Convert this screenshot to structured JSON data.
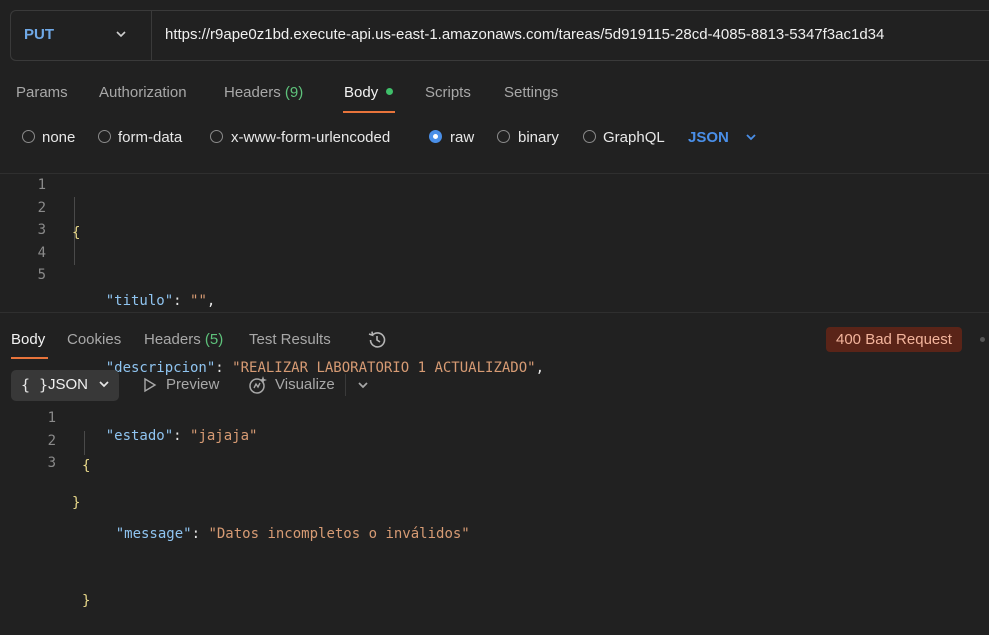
{
  "request": {
    "method": "PUT",
    "url": "https://r9ape0z1bd.execute-api.us-east-1.amazonaws.com/tareas/5d919115-28cd-4085-8813-5347f3ac1d34"
  },
  "request_tabs": {
    "params": "Params",
    "authorization": "Authorization",
    "headers": "Headers",
    "headers_count": "(9)",
    "body": "Body",
    "scripts": "Scripts",
    "settings": "Settings"
  },
  "body_types": {
    "none": "none",
    "form_data": "form-data",
    "urlencoded": "x-www-form-urlencoded",
    "raw": "raw",
    "binary": "binary",
    "graphql": "GraphQL",
    "format": "JSON",
    "selected": "raw"
  },
  "editor": {
    "line_numbers": [
      "1",
      "2",
      "3",
      "4",
      "5"
    ],
    "open_brace": "{",
    "close_brace": "}",
    "key1": "\"titulo\"",
    "val1": "\"\"",
    "key2": "\"descripcion\"",
    "val2": "\"REALIZAR LABORATORIO 1 ACTUALIZADO\"",
    "key3": "\"estado\"",
    "val3": "\"jajaja\""
  },
  "response_tabs": {
    "body": "Body",
    "cookies": "Cookies",
    "headers": "Headers",
    "headers_count": "(5)",
    "test_results": "Test Results"
  },
  "response": {
    "status": "400 Bad Request",
    "format_icon": "{ }",
    "format": "JSON",
    "preview": "Preview",
    "visualize": "Visualize",
    "line_numbers": [
      "1",
      "2",
      "3"
    ],
    "open_brace": "{",
    "close_brace": "}",
    "key": "\"message\"",
    "value": "\"Datos incompletos o inválidos\""
  },
  "colors": {
    "accent": "#e8743b",
    "link_blue": "#4a8fe8",
    "status_bg": "#5a2418",
    "status_fg": "#f3b49c",
    "count_green": "#5ec27b"
  }
}
